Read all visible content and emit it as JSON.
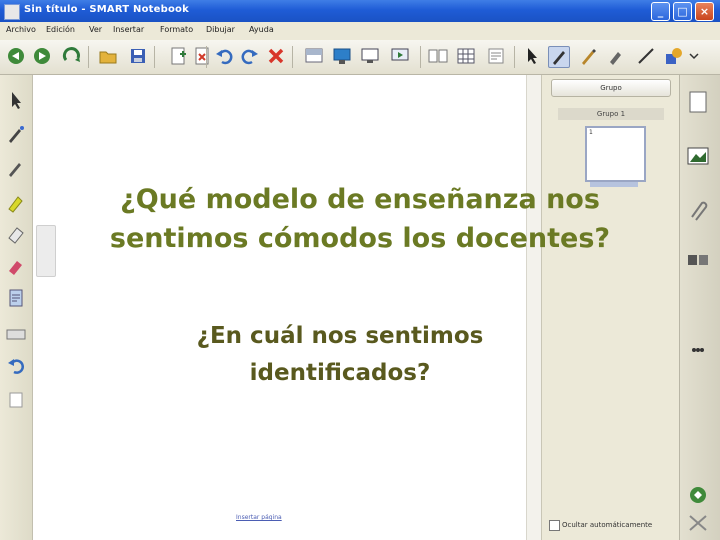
{
  "window": {
    "title": "Sin título - SMART Notebook"
  },
  "menu": [
    "Archivo",
    "Edición",
    "Ver",
    "Insertar",
    "Formato",
    "Dibujar",
    "Ayuda"
  ],
  "side_panel": {
    "group_dropdown": "Grupo",
    "group_name": "Grupo 1",
    "page_number": "1",
    "autohide_label": "Ocultar automáticamente"
  },
  "slide": {
    "heading_line1": "¿Qué modelo de enseñanza nos",
    "heading_line2": "sentimos cómodos los docentes?",
    "subheading_line1": "¿En cuál nos sentimos",
    "subheading_line2": "identificados?"
  },
  "canvas_link": "Insertar página",
  "colors": {
    "heading": "#6b7a24",
    "subheading": "#59591e",
    "titlebar": "#1f5cd6",
    "chrome": "#ece9d8"
  },
  "icons": [
    "back-icon",
    "forward-icon",
    "refresh-icon",
    "open-file-icon",
    "save-icon",
    "new-page-icon",
    "delete-page-icon",
    "screen-shade-icon",
    "undo-icon",
    "redo-icon",
    "delete-icon",
    "table-icon",
    "display-icon",
    "capture-icon",
    "share-icon",
    "select-icon",
    "pen-icon",
    "creative-pen-icon",
    "line-icon",
    "shapes-icon"
  ]
}
